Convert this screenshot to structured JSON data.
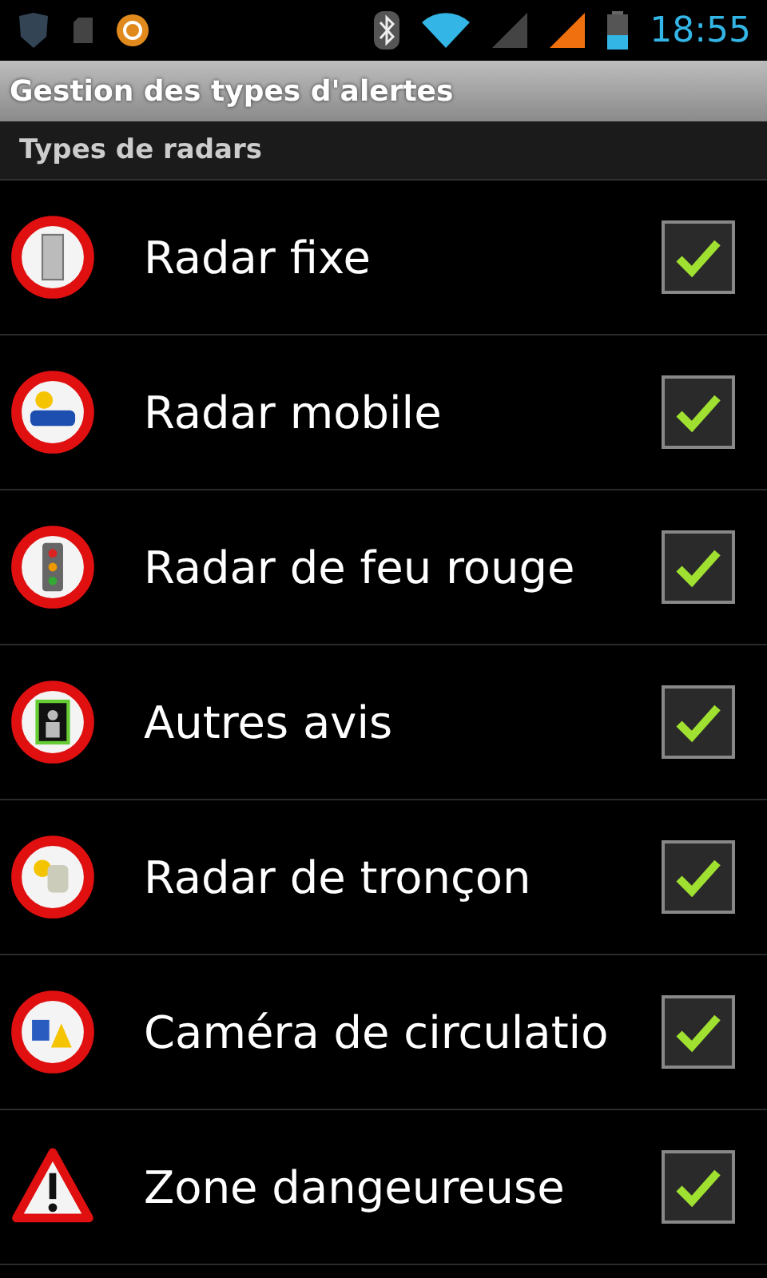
{
  "status_bar": {
    "time": "18:55"
  },
  "title": "Gestion des types d'alertes",
  "section": "Types de radars",
  "items": [
    {
      "label": "Radar fixe",
      "kind": "fixed",
      "checked": true
    },
    {
      "label": "Radar mobile",
      "kind": "mobile",
      "checked": true
    },
    {
      "label": "Radar de feu rouge",
      "kind": "light",
      "checked": true
    },
    {
      "label": "Autres avis",
      "kind": "other",
      "checked": true
    },
    {
      "label": "Radar de tronçon",
      "kind": "section",
      "checked": true
    },
    {
      "label": "Caméra de circulatio",
      "kind": "camera",
      "checked": true
    },
    {
      "label": "Zone dangeureuse",
      "kind": "danger",
      "checked": true
    }
  ]
}
